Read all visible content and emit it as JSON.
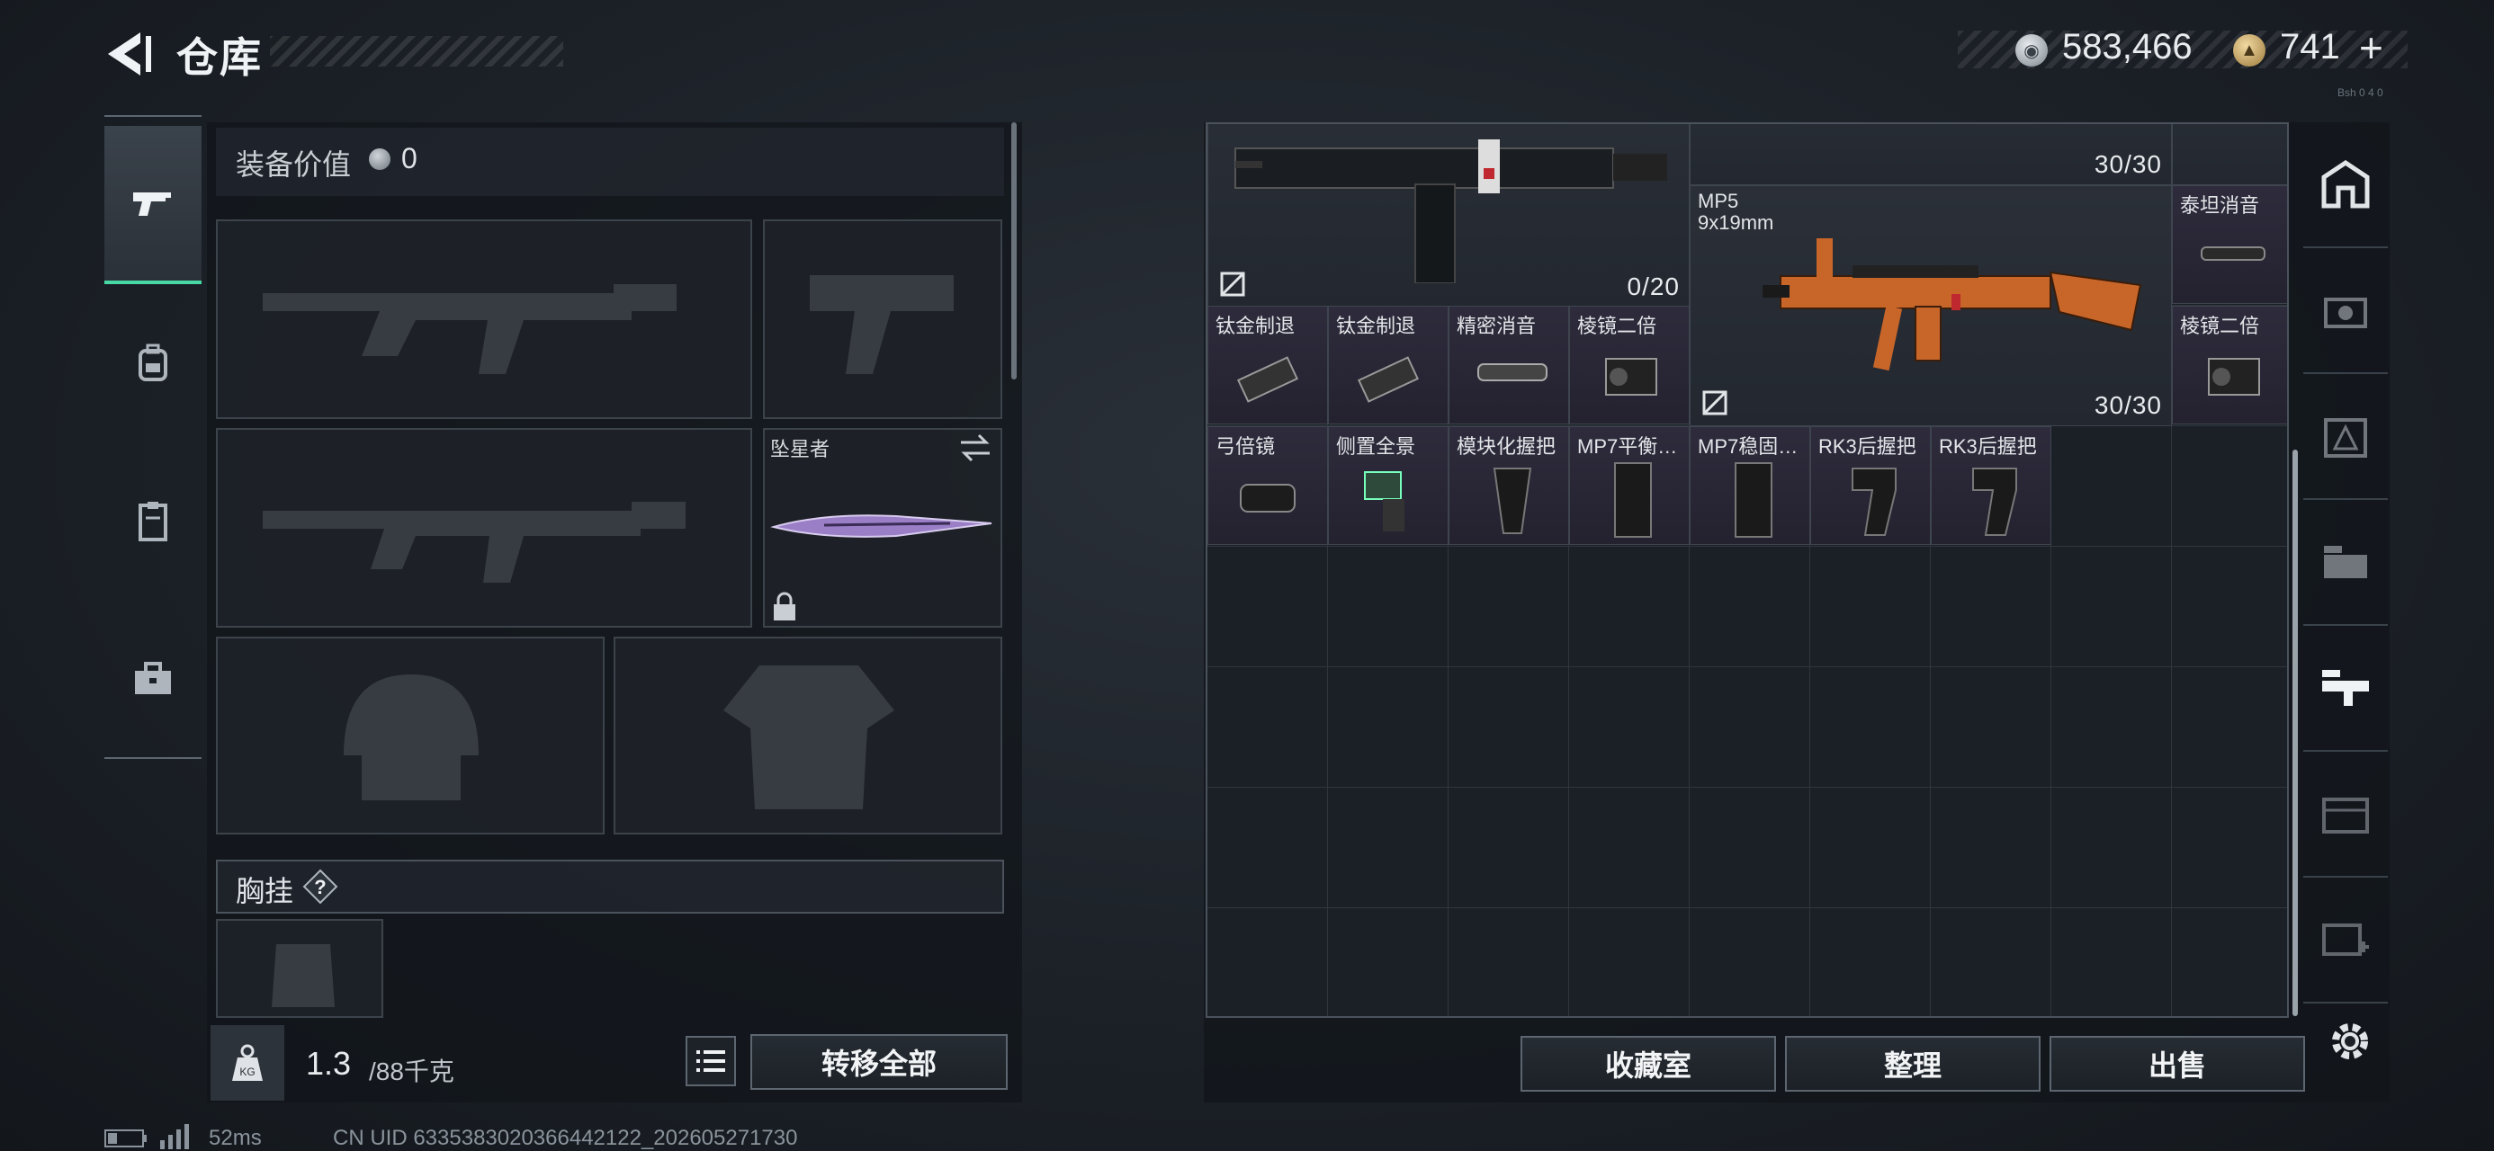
{
  "header": {
    "title": "仓库",
    "silver_value": "583,466",
    "gold_value": "741",
    "gold_plus": "+",
    "version": "Bsh 0 4 0"
  },
  "left_tabs": [
    {
      "icon": "weapon-icon",
      "active": true
    },
    {
      "icon": "backpack-icon",
      "active": false
    },
    {
      "icon": "clipboard-icon",
      "active": false
    },
    {
      "icon": "toolbox-icon",
      "active": false
    }
  ],
  "loadout": {
    "equip_value_label": "装备价值",
    "equip_value": "0",
    "knife_name": "坠星者",
    "chest_label": "胸挂",
    "chest_help": "?",
    "weight_value": "1.3",
    "weight_max": "/88千克",
    "transfer_label": "转移全部"
  },
  "stash": {
    "items": [
      {
        "name": "",
        "sub": "",
        "count": "0/20",
        "kind": "smg-folded"
      },
      {
        "name": "",
        "sub": "",
        "count": "30/30",
        "kind": "magazine"
      },
      {
        "name": "MP5",
        "sub": "9x19mm",
        "count": "30/30",
        "kind": "mp5"
      },
      {
        "name": "泰坦消音",
        "kind": "suppressor"
      },
      {
        "name": "钛金制退",
        "kind": "muzzle-brake"
      },
      {
        "name": "钛金制退",
        "kind": "muzzle-brake"
      },
      {
        "name": "精密消音",
        "kind": "suppressor-small"
      },
      {
        "name": "棱镜二倍",
        "kind": "prism-scope"
      },
      {
        "name": "棱镜二倍",
        "kind": "prism-scope"
      },
      {
        "name": "弓倍镜",
        "kind": "scope"
      },
      {
        "name": "侧置全景",
        "kind": "side-sight"
      },
      {
        "name": "模块化握把",
        "kind": "grip"
      },
      {
        "name": "MP7平衡…",
        "kind": "mag-grip"
      },
      {
        "name": "MP7稳固…",
        "kind": "mag-grip"
      },
      {
        "name": "RK3后握把",
        "kind": "rear-grip"
      },
      {
        "name": "RK3后握把",
        "kind": "rear-grip"
      }
    ],
    "collection_label": "收藏室",
    "organize_label": "整理",
    "sell_label": "出售"
  },
  "right_tabs": [
    {
      "icon": "home-base-icon"
    },
    {
      "icon": "vehicle-icon"
    },
    {
      "icon": "gear-tier-3-icon"
    },
    {
      "icon": "gear-tier-3-set-icon"
    },
    {
      "icon": "weapon-tier-3-icon",
      "active": true
    },
    {
      "icon": "gear-tier-4-icon"
    },
    {
      "icon": "medical-tier-4-icon"
    }
  ],
  "footer": {
    "ping": "52ms",
    "uid": "CN UID 6335383020366442122_202605271730"
  },
  "colors": {
    "accent": "#47d8a6",
    "panel": "#1b2026",
    "orange_skin": "#c8662a"
  }
}
